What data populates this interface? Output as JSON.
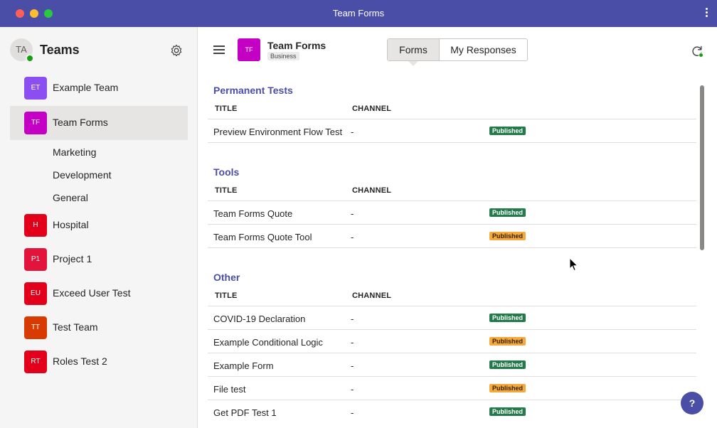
{
  "window": {
    "title": "Team Forms"
  },
  "sidebar": {
    "avatar_initials": "TA",
    "title": "Teams",
    "teams": [
      {
        "initials": "ET",
        "label": "Example Team",
        "color": "#8a4ef1"
      },
      {
        "initials": "TF",
        "label": "Team Forms",
        "color": "#c400c4",
        "active": true
      },
      {
        "initials": "H",
        "label": "Hospital",
        "color": "#e3001b"
      },
      {
        "initials": "P1",
        "label": "Project 1",
        "color": "#e3143c"
      },
      {
        "initials": "EU",
        "label": "Exceed User Test",
        "color": "#e3001b"
      },
      {
        "initials": "TT",
        "label": "Test Team",
        "color": "#d83b01"
      },
      {
        "initials": "RT",
        "label": "Roles Test 2",
        "color": "#e3001b"
      }
    ],
    "channels": [
      "Marketing",
      "Development",
      "General"
    ]
  },
  "header": {
    "app_initials": "TF",
    "app_name": "Team Forms",
    "app_badge": "Business",
    "tabs": [
      "Forms",
      "My Responses"
    ]
  },
  "sections": [
    {
      "title": "Permanent Tests",
      "col_title": "TITLE",
      "col_channel": "CHANNEL",
      "rows": [
        {
          "title": "Preview Environment Flow Test",
          "channel": "-",
          "status": "Published",
          "status_color": "#237b4b"
        }
      ]
    },
    {
      "title": "Tools",
      "col_title": "TITLE",
      "col_channel": "CHANNEL",
      "rows": [
        {
          "title": "Team Forms Quote",
          "channel": "-",
          "status": "Published",
          "status_color": "#237b4b"
        },
        {
          "title": "Team Forms Quote Tool",
          "channel": "-",
          "status": "Published",
          "status_color": "#f4a93b"
        }
      ]
    },
    {
      "title": "Other",
      "col_title": "TITLE",
      "col_channel": "CHANNEL",
      "rows": [
        {
          "title": "COVID-19 Declaration",
          "channel": "-",
          "status": "Published",
          "status_color": "#237b4b"
        },
        {
          "title": "Example Conditional Logic",
          "channel": "-",
          "status": "Published",
          "status_color": "#f4a93b"
        },
        {
          "title": "Example Form",
          "channel": "-",
          "status": "Published",
          "status_color": "#237b4b"
        },
        {
          "title": "File test",
          "channel": "-",
          "status": "Published",
          "status_color": "#f4a93b"
        },
        {
          "title": "Get PDF Test 1",
          "channel": "-",
          "status": "Published",
          "status_color": "#237b4b"
        }
      ]
    }
  ],
  "help_label": "?",
  "colors": {
    "accent": "#4b4ea6",
    "published_green": "#237b4b",
    "published_orange": "#f4a93b"
  }
}
